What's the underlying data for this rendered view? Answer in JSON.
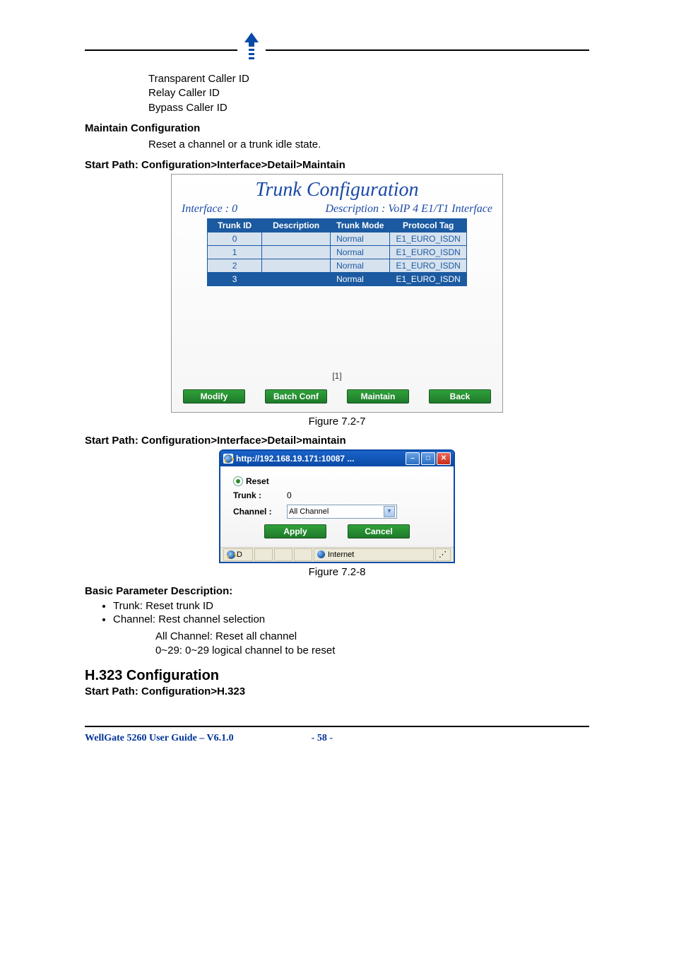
{
  "intro": {
    "line1": "Transparent Caller ID",
    "line2": "Relay Caller ID",
    "line3": "Bypass Caller ID"
  },
  "maintain_heading": "Maintain Configuration",
  "maintain_text": "Reset a channel or a trunk idle state.",
  "startpath1": "Start Path: Configuration>Interface>Detail>Maintain",
  "fig727": {
    "title": "Trunk Configuration",
    "interface_label": "Interface : 0",
    "description_label": "Description : VoIP 4 E1/T1 Interface",
    "headers": [
      "Trunk ID",
      "Description",
      "Trunk Mode",
      "Protocol Tag"
    ],
    "rows": [
      {
        "id": "0",
        "desc": "",
        "mode": "Normal",
        "tag": "E1_EURO_ISDN",
        "selected": false
      },
      {
        "id": "1",
        "desc": "",
        "mode": "Normal",
        "tag": "E1_EURO_ISDN",
        "selected": false
      },
      {
        "id": "2",
        "desc": "",
        "mode": "Normal",
        "tag": "E1_EURO_ISDN",
        "selected": false
      },
      {
        "id": "3",
        "desc": "",
        "mode": "Normal",
        "tag": "E1_EURO_ISDN",
        "selected": true
      }
    ],
    "pager": "[1]",
    "buttons": {
      "modify": "Modify",
      "batch": "Batch Conf",
      "maintain": "Maintain",
      "back": "Back"
    },
    "caption": "Figure 7.2-7"
  },
  "startpath2": "Start Path: Configuration>Interface>Detail>maintain",
  "fig728": {
    "windowtitle": "http://192.168.19.171:10087 ...",
    "reset_label": "Reset",
    "trunk_label": "Trunk :",
    "trunk_value": "0",
    "channel_label": "Channel :",
    "channel_value": "All Channel",
    "apply": "Apply",
    "cancel": "Cancel",
    "status_d": "D",
    "status_zone": "Internet",
    "caption": "Figure 7.2-8"
  },
  "basic_param_heading": "Basic Parameter Description:",
  "bullets": {
    "b1": "Trunk: Reset trunk ID",
    "b2": "Channel: Rest channel selection",
    "sub1": "All Channel: Reset all channel",
    "sub2": "0~29: 0~29 logical channel to be reset"
  },
  "h323_heading": "H.323 Configuration",
  "h323_path": "Start Path: Configuration>H.323",
  "footer": {
    "left": "WellGate 5260 User Guide – V6.1.0",
    "page": "- 58 -"
  }
}
